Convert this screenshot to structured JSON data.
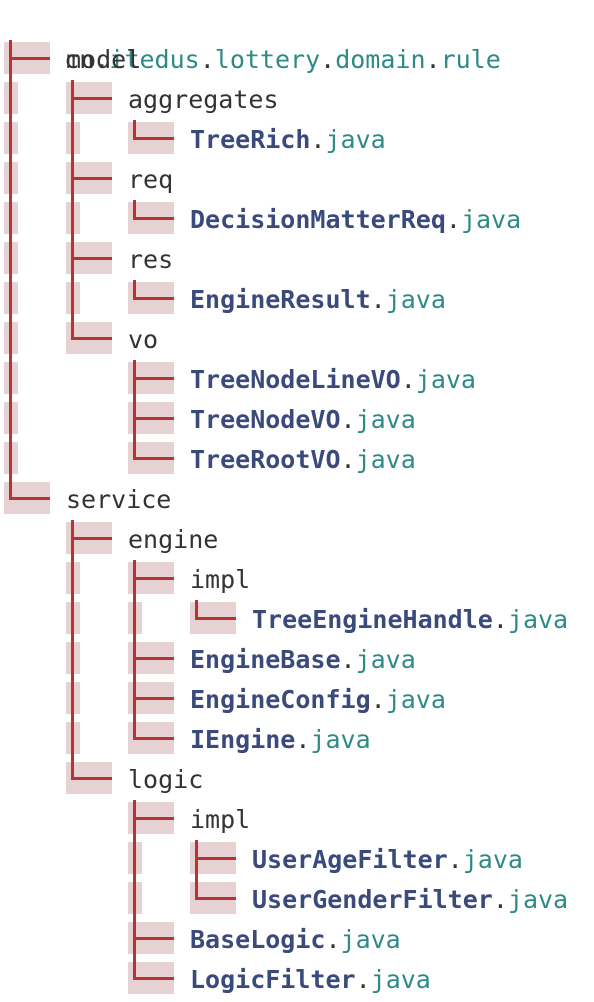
{
  "root": {
    "parts": [
      "cn",
      "itedus",
      "lottery",
      "domain",
      "rule"
    ]
  },
  "tree": [
    {
      "prefix": [
        "tee"
      ],
      "type": "dir",
      "name": "model"
    },
    {
      "prefix": [
        "pipe",
        "tee"
      ],
      "type": "dir",
      "name": "aggregates"
    },
    {
      "prefix": [
        "pipe",
        "pipe",
        "corner"
      ],
      "type": "file",
      "name": "TreeRich",
      "ext": "java"
    },
    {
      "prefix": [
        "pipe",
        "tee"
      ],
      "type": "dir",
      "name": "req"
    },
    {
      "prefix": [
        "pipe",
        "pipe",
        "corner"
      ],
      "type": "file",
      "name": "DecisionMatterReq",
      "ext": "java"
    },
    {
      "prefix": [
        "pipe",
        "tee"
      ],
      "type": "dir",
      "name": "res"
    },
    {
      "prefix": [
        "pipe",
        "pipe",
        "corner"
      ],
      "type": "file",
      "name": "EngineResult",
      "ext": "java"
    },
    {
      "prefix": [
        "pipe",
        "corner"
      ],
      "type": "dir",
      "name": "vo"
    },
    {
      "prefix": [
        "pipe",
        "space",
        "tee"
      ],
      "type": "file",
      "name": "TreeNodeLineVO",
      "ext": "java"
    },
    {
      "prefix": [
        "pipe",
        "space",
        "tee"
      ],
      "type": "file",
      "name": "TreeNodeVO",
      "ext": "java"
    },
    {
      "prefix": [
        "pipe",
        "space",
        "corner"
      ],
      "type": "file",
      "name": "TreeRootVO",
      "ext": "java"
    },
    {
      "prefix": [
        "corner"
      ],
      "type": "dir",
      "name": "service"
    },
    {
      "prefix": [
        "space",
        "tee"
      ],
      "type": "dir",
      "name": "engine"
    },
    {
      "prefix": [
        "space",
        "pipe",
        "tee"
      ],
      "type": "dir",
      "name": "impl"
    },
    {
      "prefix": [
        "space",
        "pipe",
        "pipe",
        "corner"
      ],
      "type": "file",
      "name": "TreeEngineHandle",
      "ext": "java"
    },
    {
      "prefix": [
        "space",
        "pipe",
        "tee"
      ],
      "type": "file",
      "name": "EngineBase",
      "ext": "java"
    },
    {
      "prefix": [
        "space",
        "pipe",
        "tee"
      ],
      "type": "file",
      "name": "EngineConfig",
      "ext": "java"
    },
    {
      "prefix": [
        "space",
        "pipe",
        "corner"
      ],
      "type": "file",
      "name": "IEngine",
      "ext": "java"
    },
    {
      "prefix": [
        "space",
        "corner"
      ],
      "type": "dir",
      "name": "logic"
    },
    {
      "prefix": [
        "space",
        "space",
        "tee"
      ],
      "type": "dir",
      "name": "impl"
    },
    {
      "prefix": [
        "space",
        "space",
        "pipe",
        "tee"
      ],
      "type": "file",
      "name": "UserAgeFilter",
      "ext": "java"
    },
    {
      "prefix": [
        "space",
        "space",
        "pipe",
        "corner"
      ],
      "type": "file",
      "name": "UserGenderFilter",
      "ext": "java"
    },
    {
      "prefix": [
        "space",
        "space",
        "tee"
      ],
      "type": "file",
      "name": "BaseLogic",
      "ext": "java"
    },
    {
      "prefix": [
        "space",
        "space",
        "corner"
      ],
      "type": "file",
      "name": "LogicFilter",
      "ext": "java"
    }
  ],
  "colors": {
    "text": "#333333",
    "package_segment": "#2d8a86",
    "file_class": "#3a4a7c",
    "file_extension": "#2d8a86",
    "guide_line": "#b83333",
    "guide_highlight": "#e6d2d2"
  }
}
